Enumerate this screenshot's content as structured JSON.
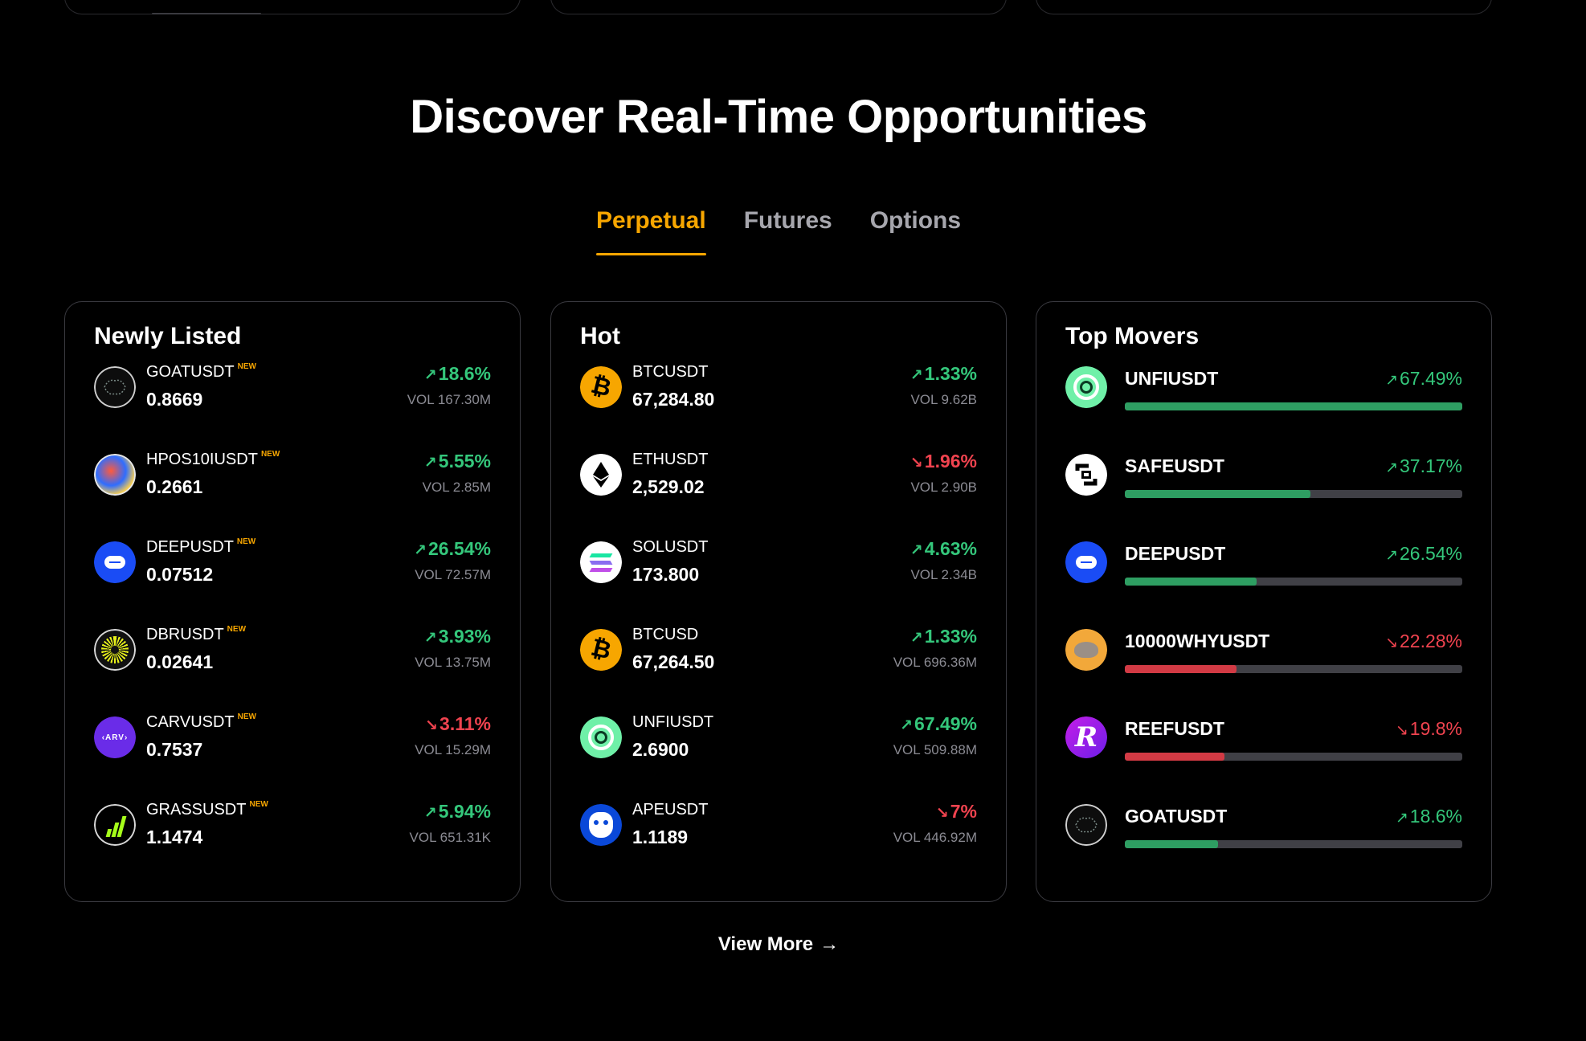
{
  "heading": "Discover Real-Time Opportunities",
  "tabs": [
    {
      "label": "Perpetual",
      "active": true
    },
    {
      "label": "Futures",
      "active": false
    },
    {
      "label": "Options",
      "active": false
    }
  ],
  "newly_listed": {
    "title": "Newly Listed",
    "items": [
      {
        "symbol": "GOATUSDT",
        "badge": "NEW",
        "price": "0.8669",
        "change": "18.6%",
        "dir": "up",
        "vol": "VOL 167.30M",
        "icon": "goat-icon"
      },
      {
        "symbol": "HPOS10IUSDT",
        "badge": "NEW",
        "price": "0.2661",
        "change": "5.55%",
        "dir": "up",
        "vol": "VOL 2.85M",
        "icon": "hpos10i-icon"
      },
      {
        "symbol": "DEEPUSDT",
        "badge": "NEW",
        "price": "0.07512",
        "change": "26.54%",
        "dir": "up",
        "vol": "VOL 72.57M",
        "icon": "deep-icon"
      },
      {
        "symbol": "DBRUSDT",
        "badge": "NEW",
        "price": "0.02641",
        "change": "3.93%",
        "dir": "up",
        "vol": "VOL 13.75M",
        "icon": "dbr-icon"
      },
      {
        "symbol": "CARVUSDT",
        "badge": "NEW",
        "price": "0.7537",
        "change": "3.11%",
        "dir": "down",
        "vol": "VOL 15.29M",
        "icon": "carv-icon"
      },
      {
        "symbol": "GRASSUSDT",
        "badge": "NEW",
        "price": "1.1474",
        "change": "5.94%",
        "dir": "up",
        "vol": "VOL 651.31K",
        "icon": "grass-icon"
      }
    ]
  },
  "hot": {
    "title": "Hot",
    "items": [
      {
        "symbol": "BTCUSDT",
        "price": "67,284.80",
        "change": "1.33%",
        "dir": "up",
        "vol": "VOL 9.62B",
        "icon": "bitcoin-icon"
      },
      {
        "symbol": "ETHUSDT",
        "price": "2,529.02",
        "change": "1.96%",
        "dir": "down",
        "vol": "VOL 2.90B",
        "icon": "ethereum-icon"
      },
      {
        "symbol": "SOLUSDT",
        "price": "173.800",
        "change": "4.63%",
        "dir": "up",
        "vol": "VOL 2.34B",
        "icon": "solana-icon"
      },
      {
        "symbol": "BTCUSD",
        "price": "67,264.50",
        "change": "1.33%",
        "dir": "up",
        "vol": "VOL 696.36M",
        "icon": "bitcoin-icon"
      },
      {
        "symbol": "UNFIUSDT",
        "price": "2.6900",
        "change": "67.49%",
        "dir": "up",
        "vol": "VOL 509.88M",
        "icon": "unfi-icon"
      },
      {
        "symbol": "APEUSDT",
        "price": "1.1189",
        "change": "7%",
        "dir": "down",
        "vol": "VOL 446.92M",
        "icon": "ape-icon"
      }
    ]
  },
  "top_movers": {
    "title": "Top Movers",
    "items": [
      {
        "symbol": "UNFIUSDT",
        "change": "67.49%",
        "dir": "up",
        "level": 1.0,
        "icon": "unfi-icon"
      },
      {
        "symbol": "SAFEUSDT",
        "change": "37.17%",
        "dir": "up",
        "level": 0.55,
        "icon": "safe-icon"
      },
      {
        "symbol": "DEEPUSDT",
        "change": "26.54%",
        "dir": "up",
        "level": 0.39,
        "icon": "deep-icon"
      },
      {
        "symbol": "10000WHYUSDT",
        "change": "22.28%",
        "dir": "down",
        "level": 0.33,
        "icon": "why-icon"
      },
      {
        "symbol": "REEFUSDT",
        "change": "19.8%",
        "dir": "down",
        "level": 0.295,
        "icon": "reef-icon"
      },
      {
        "symbol": "GOATUSDT",
        "change": "18.6%",
        "dir": "up",
        "level": 0.275,
        "icon": "goat-icon"
      }
    ]
  },
  "view_more": "View More",
  "colors": {
    "accent": "#f7a600",
    "up": "#34c77b",
    "down": "#f0434f"
  }
}
